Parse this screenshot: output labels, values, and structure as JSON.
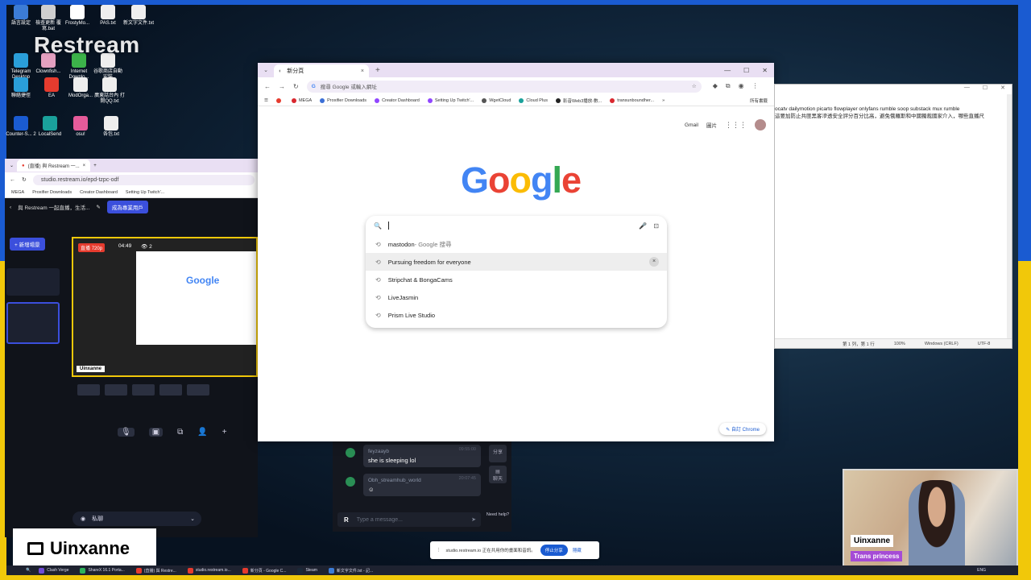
{
  "desktop": {
    "brand": "Restream",
    "icons": [
      {
        "label": "語言設定",
        "color": "#3c7cd6"
      },
      {
        "label": "檢查更新 覆寫.bat",
        "color": "#cfcfcf"
      },
      {
        "label": "FrostyMo...",
        "color": "#ffffff"
      },
      {
        "label": "PAS.txt",
        "color": "#eeeeee"
      },
      {
        "label": "新文字文件.txt",
        "color": "#eeeeee"
      },
      {
        "label": "Telegram Desktop",
        "color": "#2a9ed9"
      },
      {
        "label": "Clownfish...",
        "color": "#e3a0c0"
      },
      {
        "label": "Internet Downlo...",
        "color": "#3cb34a"
      },
      {
        "label": "谷歌商店自動安裝",
        "color": "#eeeeee"
      },
      {
        "label": "聯絡捷徑",
        "color": "#2a9ed9"
      },
      {
        "label": "EA",
        "color": "#e63b2e"
      },
      {
        "label": "ModOrga...",
        "color": "#eeeeee"
      },
      {
        "label": "廣東話台內 打開QQ.txt",
        "color": "#eeeeee"
      },
      {
        "label": "Counter-S... 2",
        "color": "#1a5bd1"
      },
      {
        "label": "LocalSend",
        "color": "#1aa19b"
      },
      {
        "label": "osu!",
        "color": "#e55b9a"
      },
      {
        "label": "各包.txt",
        "color": "#eeeeee"
      }
    ]
  },
  "studio": {
    "tab_title": "(直播) 與 Restream 一...",
    "url": "studio.restream.io/epd-tzpc-odf",
    "bookmarks": [
      "MEGA",
      "Proxifier Downloads",
      "Creator Dashboard",
      "Setting Up Twitch'..."
    ],
    "header_title": "與 Restream 一起直播，生活...",
    "pro_button": "成為專業用戶",
    "new_scene_button": "+ 新增場景",
    "live_badge": "直播",
    "resolution": "720p",
    "elapsed": "04:49",
    "viewers": "2",
    "preview_logo": "Google",
    "preview_badge": "Uinxanne",
    "privacy_label": "私聊",
    "chevron": "⌄"
  },
  "chat": {
    "messages": [
      {
        "user": "feyzaayb",
        "time": "09:55:00",
        "text": "she is sleeping lol"
      },
      {
        "user": "Obh_streamhub_world",
        "time": "20:07:45",
        "text": "☺"
      }
    ],
    "input_placeholder": "Type a message...",
    "restream_icon": "R",
    "side_buttons": [
      "分享",
      "聊天"
    ],
    "help_label": "Need help?"
  },
  "chrome": {
    "tab_title": "新分頁",
    "omnibox_placeholder": "搜尋 Google 或輸入網址",
    "bookmarks": [
      {
        "label": "",
        "color": "#e63b2e"
      },
      {
        "label": "MEGA",
        "color": "#d9272e"
      },
      {
        "label": "Proxifier Downloads",
        "color": "#3b6fd6"
      },
      {
        "label": "Creator Dashboard",
        "color": "#9146ff"
      },
      {
        "label": "Setting Up Twitch'...",
        "color": "#9146ff"
      },
      {
        "label": "WgetCloud",
        "color": "#555555"
      },
      {
        "label": "Cloud Plus",
        "color": "#1aa19b"
      },
      {
        "label": "影音Web3播放-數...",
        "color": "#222222"
      },
      {
        "label": "transunboundher...",
        "color": "#d9272e"
      }
    ],
    "all_bookmarks": "所有書籤",
    "top_links": [
      "Gmail",
      "圖片"
    ],
    "logo": [
      "G",
      "o",
      "o",
      "g",
      "l",
      "e"
    ],
    "suggestions": [
      {
        "text": "mastodon",
        "sub": " - Google 搜尋"
      },
      {
        "text": "Pursuing freedom for everyone",
        "sub": ""
      },
      {
        "text": "Stripchat & BongaCams",
        "sub": ""
      },
      {
        "text": "LiveJasmin",
        "sub": ""
      },
      {
        "text": "Prism Live Studio",
        "sub": ""
      }
    ],
    "customize": "自訂 Chrome"
  },
  "notepad": {
    "line1": "ocatv dailymotion  picarto  flowplayer  onlyfans rumble  soop substack mux  rumble",
    "line2": "這要加防止共匪黑客滲透安全評分百分比高，避免俄羅斯和中國獨裁國家介入，哪些直播尺",
    "status": [
      "第 1 列，第 1 行",
      "100%",
      "Windows (CRLF)",
      "UTF-8"
    ]
  },
  "webcam": {
    "name": "Uinxanne",
    "tag": "Trans princess"
  },
  "badge": {
    "name": "Uinxanne"
  },
  "sharebar": {
    "text": "studio.restream.io 正在共用你的畫面和音訊。",
    "stop": "停止分享",
    "hide": "隱藏"
  },
  "taskbar": {
    "items": [
      {
        "label": "Clash Verge",
        "color": "#6f4bd6"
      },
      {
        "label": "ShareX 16.1 Porta...",
        "color": "#2fb35b"
      },
      {
        "label": "(直播) 與 Restre...",
        "color": "#e63b2e"
      },
      {
        "label": "studio.restream.io...",
        "color": "#e63b2e"
      },
      {
        "label": "新分頁 - Google C...",
        "color": "#e63b2e"
      },
      {
        "label": "Steam",
        "color": "#1b2838"
      },
      {
        "label": "新文字文件.txt - 記...",
        "color": "#3c7cd6"
      }
    ],
    "tray": "ENG"
  }
}
